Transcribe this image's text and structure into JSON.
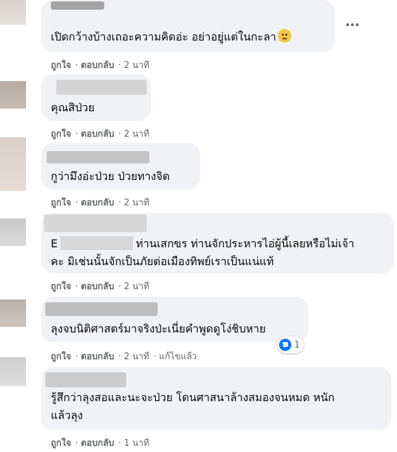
{
  "comments": [
    {
      "text_lines": [
        "เปิดกว้างบ้างเถอะความคิดอ่ะ อย่าอยู่แต่ในกะลา"
      ],
      "emoji": "worried-face",
      "like": "ถูกใจ",
      "reply": "ตอบกลับ",
      "time": "2 นาที"
    },
    {
      "text_lines": [
        "คุณสิป่วย"
      ],
      "like": "ถูกใจ",
      "reply": "ตอบกลับ",
      "time": "2 นาที"
    },
    {
      "text_lines": [
        "กูว่ามึงอ่ะป่วย ป่วยทางจิต"
      ],
      "like": "ถูกใจ",
      "reply": "ตอบกลับ",
      "time": "2 นาที"
    },
    {
      "text_lines": [
        "ท่านเสกขร ท่านจักประหารไอ่ผู้นี้เลยหรือไม่เจ้า",
        "คะ มิเช่นนั้นจักเป็นภัยต่อเมืองทิพย์เราเป็นแน่แท้"
      ],
      "name_initial": "E",
      "like": "ถูกใจ",
      "reply": "ตอบกลับ",
      "time": "2 นาที"
    },
    {
      "text_lines": [
        "ลุงจบนิติศาสตร์มาจริงป่ะเนี่ยคำพูดดูโง่ชิบหาย"
      ],
      "like": "ถูกใจ",
      "reply": "ตอบกลับ",
      "time": "2 นาที",
      "edited": "แก้ไขแล้ว",
      "reaction_count": "1"
    },
    {
      "text_lines": [
        "รู้สึกว่าลุงสอและนะจะป่วย โดนศาสนาล้างสมองจนหมด หนัก",
        "แล้วลุง"
      ],
      "like": "ถูกใจ",
      "reply": "ตอบกลับ",
      "time": "1 นาที"
    }
  ],
  "colors": {
    "bubble": "#f0f2f5",
    "meta": "#65676b",
    "like_blue": "#1877f2"
  }
}
